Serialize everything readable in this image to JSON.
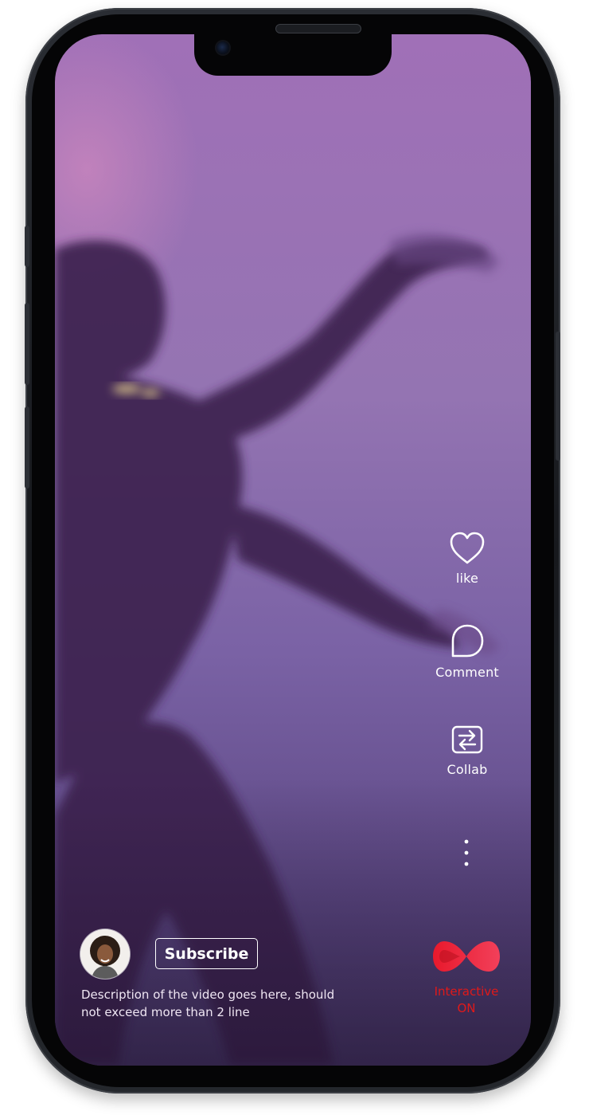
{
  "actions": {
    "like_label": "like",
    "comment_label": "Comment",
    "collab_label": "Collab",
    "more_icon": "more-vertical-icon"
  },
  "creator": {
    "subscribe_label": "Subscribe",
    "description": "Description of the video goes here, should not exceed more than 2 line"
  },
  "interactive": {
    "line1": "Interactive",
    "line2": "ON",
    "icon": "infinity-icon",
    "color": "#e01919"
  },
  "colors": {
    "background_top": "#a070b7",
    "background_bottom": "#4a3a6b",
    "text": "#ffffff"
  }
}
